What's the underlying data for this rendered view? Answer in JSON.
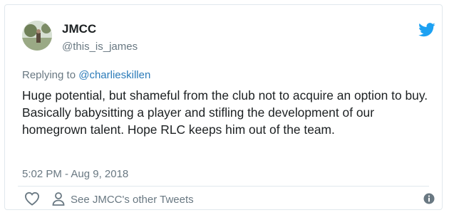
{
  "user": {
    "name": "JMCC",
    "handle": "@this_is_james"
  },
  "reply": {
    "prefix": "Replying to ",
    "to": "@charlieskillen"
  },
  "tweet": {
    "text": "Huge potential, but shameful from the club not to acquire an option to buy. Basically babysitting a player and stifling the development of our homegrown talent. Hope RLC keeps him out of the team.",
    "timestamp": "5:02 PM - Aug 9, 2018"
  },
  "actions": {
    "other_tweets": "See JMCC's other Tweets"
  },
  "icons": {
    "brand": "twitter-bird-icon",
    "like": "heart-icon",
    "profile": "person-icon",
    "info": "info-icon"
  },
  "colors": {
    "brand": "#1da1f2",
    "link": "#2b7bb9",
    "muted": "#697882",
    "text": "#1c2022",
    "border": "#e1e8ed"
  }
}
